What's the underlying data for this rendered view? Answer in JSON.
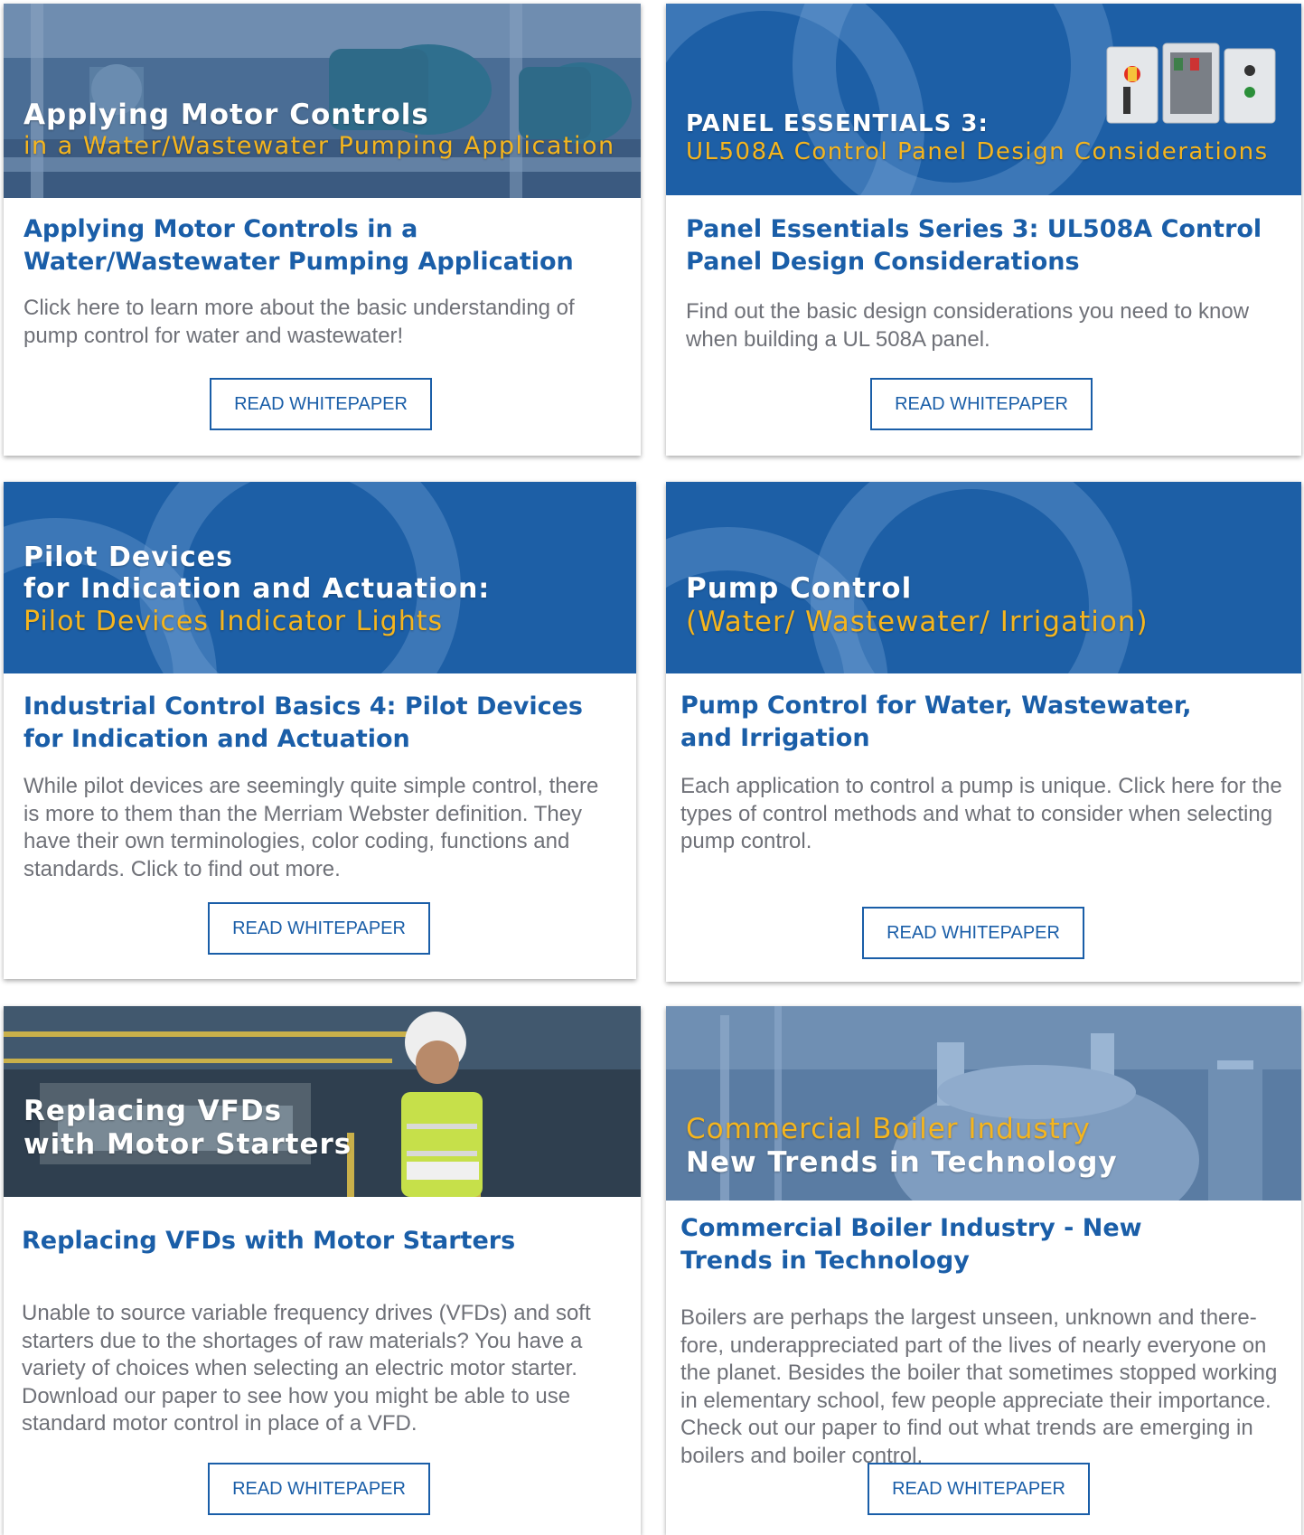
{
  "cards": [
    {
      "banner": {
        "line1": "Applying Motor Controls",
        "line2": "in a Water/Wastewater Pumping Application"
      },
      "title": "Applying Motor Controls in a Water/Wastewater Pumping Application",
      "description": "Click here to learn more about the basic understanding of pump control for water and wastewater!",
      "button": "READ WHITEPAPER"
    },
    {
      "banner": {
        "line1": "PANEL ESSENTIALS 3:",
        "line2": "UL508A Control Panel Design Considerations"
      },
      "title": "Panel Essentials Series 3: UL508A Control Panel Design Considerations",
      "description": "Find out the basic design considerations you need to know when building a UL 508A panel.",
      "button": "READ WHITEPAPER"
    },
    {
      "banner": {
        "line1": "Pilot Devices",
        "line2": "for Indication and Actuation:",
        "line3": "Pilot Devices Indicator Lights"
      },
      "title": "Industrial Control Basics 4: Pilot Devices for Indication and Actuation",
      "description": "While pilot devices are seemingly quite simple control, there is more to them than the Merriam Webster definition. They have their own terminologies, color coding, functions and standards. Click to find out more.",
      "button": "READ WHITEPAPER"
    },
    {
      "banner": {
        "line1": "Pump Control",
        "line2": "(Water/ Wastewater/ Irrigation)"
      },
      "title": "Pump Control for Water, Wastewater, and Irrigation",
      "description": "Each application to control a pump is unique. Click here for the types of control methods and what to consider when selecting pump control.",
      "button": "READ WHITEPAPER"
    },
    {
      "banner": {
        "line1": "Replacing VFDs",
        "line2": "with Motor Starters"
      },
      "title": "Replacing VFDs with Motor Starters",
      "description": "Unable to source variable frequency drives (VFDs) and soft starters due to the shortages of raw materials? You have a variety of choices when selecting an electric motor starter. Download our paper to see how you might be able to use standard motor control in place of a VFD.",
      "button": "READ WHITEPAPER"
    },
    {
      "banner": {
        "line1": "Commercial Boiler Industry",
        "line2": "New Trends in Technology"
      },
      "title": "Commercial Boiler Industry - New Trends in Technology",
      "description": "Boilers are perhaps the largest unseen, unknown and there-fore, underappreciated part of the lives of nearly everyone on the planet. Besides the boiler that sometimes stopped working in elementary school, few people appreciate their importance. Check out our paper to find out what trends are emerging in boilers and boiler control.",
      "button": "READ WHITEPAPER"
    }
  ]
}
